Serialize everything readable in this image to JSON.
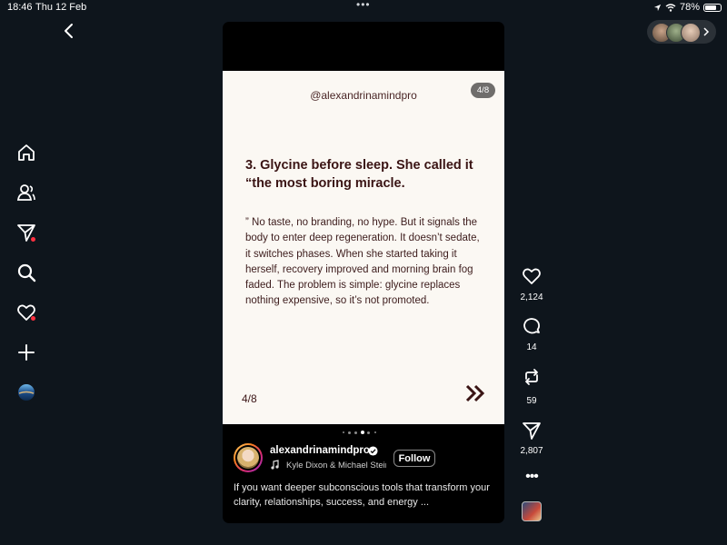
{
  "status_bar": {
    "time": "18:46",
    "date": "Thu 12 Feb",
    "dots": "•••",
    "battery": "78%",
    "battery_level": 0.78
  },
  "slide": {
    "handle": "@alexandrinamindpro",
    "counter_badge": "4/8",
    "heading": "3. Glycine before sleep. She called it “the most boring miracle.",
    "body": "” No taste, no branding, no hype. But it signals the body to enter deep regeneration. It doesn’t sedate, it switches phases. When she started taking it herself, recovery improved and morning brain fog faded. The problem is simple: glycine replaces nothing expensive, so it’s not promoted.",
    "page_label": "4/8",
    "current_index": 4,
    "total": 8
  },
  "author": {
    "username": "alexandrinamindpro",
    "music": "Kyle Dixon & Michael Stein",
    "follow_label": "Follow"
  },
  "caption": "If you want deeper subconscious tools that transform your clarity, relationships, success, and energy ...",
  "actions": {
    "likes": "2,124",
    "comments": "14",
    "reposts": "59",
    "shares": "2,807"
  },
  "colors": {
    "background": "#0e151c",
    "slide_bg": "#fbf8f3",
    "slide_text": "#3a1414",
    "notification_dot": "#ff3040"
  },
  "sidebar_icons": [
    "home-icon",
    "people-icon",
    "send-icon",
    "search-icon",
    "heart-icon",
    "plus-icon",
    "globe-icon"
  ],
  "action_icons": [
    "heart-icon",
    "comment-icon",
    "repost-icon",
    "send-icon",
    "more-icon"
  ]
}
